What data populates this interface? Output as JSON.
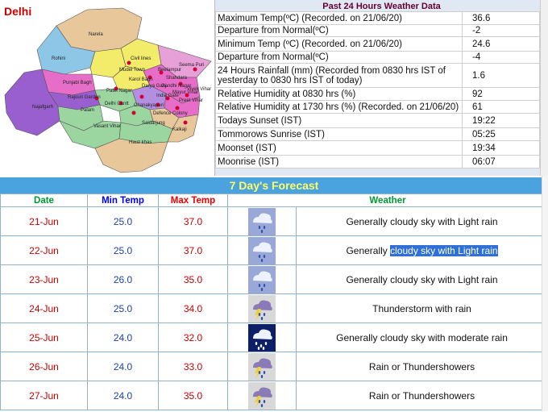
{
  "city": "Delhi",
  "map": {
    "districts": [
      "Narela",
      "Rohini",
      "Civil lines",
      "Seema Puri",
      "Mudel Town",
      "Shahdara",
      "Punjabi Bagh",
      "Karol Bagh",
      "Darya Ganj",
      "Rajouri Garden",
      "Patel Nagar",
      "Delhi Cantt",
      "Preet Vihar",
      "Najafgarh",
      "Palam",
      "Chanakyapuri",
      "Defence Colony",
      "Vasant Vihar",
      "Saidarjung",
      "Kalkaji",
      "Hauz khas",
      "Beelampur",
      "Gandhi Nagar",
      "Vivek Vihar",
      "Mayur Vihar",
      "India Gate"
    ]
  },
  "past": {
    "title": "Past 24 Hours Weather Data",
    "rows": [
      {
        "label": "Maximum Temp(ºC) (Recorded. on 21/06/20)",
        "value": "36.6"
      },
      {
        "label": "Departure from Normal(ºC)",
        "value": "-2"
      },
      {
        "label": "Minimum Temp (ºC) (Recorded. on 21/06/20)",
        "value": "24.6"
      },
      {
        "label": "Departure from Normal(ºC)",
        "value": "-4"
      },
      {
        "label": "24 Hours Rainfall (mm) (Recorded from 0830 hrs IST of yesterday to 0830 hrs IST of today)",
        "value": "1.6"
      },
      {
        "label": "Relative Humidity at 0830 hrs (%)",
        "value": "92"
      },
      {
        "label": "Relative Humidity at 1730 hrs (%) (Recorded. on 21/06/20)",
        "value": "61"
      },
      {
        "label": "Todays Sunset (IST)",
        "value": "19:22"
      },
      {
        "label": "Tommorows Sunrise (IST)",
        "value": "05:25"
      },
      {
        "label": "Moonset (IST)",
        "value": "19:34"
      },
      {
        "label": "Moonrise (IST)",
        "value": "06:07"
      }
    ]
  },
  "forecast": {
    "title": "7 Day's Forecast",
    "headers": {
      "date": "Date",
      "min": "Min Temp",
      "max": "Max Temp",
      "weather": "Weather"
    },
    "rows": [
      {
        "date": "21-Jun",
        "min": "25.0",
        "max": "37.0",
        "icon": "cloudy-light-rain-icon",
        "weather": "Generally cloudy sky with Light rain"
      },
      {
        "date": "22-Jun",
        "min": "25.0",
        "max": "37.0",
        "icon": "cloudy-light-rain-icon",
        "weather_pre": "Generally ",
        "weather_sel": "cloudy sky with Light rain"
      },
      {
        "date": "23-Jun",
        "min": "26.0",
        "max": "35.0",
        "icon": "cloudy-light-rain-icon",
        "weather": "Generally cloudy sky with Light rain"
      },
      {
        "date": "24-Jun",
        "min": "25.0",
        "max": "34.0",
        "icon": "thunderstorm-rain-icon",
        "weather": "Thunderstorm with rain"
      },
      {
        "date": "25-Jun",
        "min": "24.0",
        "max": "32.0",
        "icon": "moderate-rain-icon",
        "weather": "Generally cloudy sky with moderate rain"
      },
      {
        "date": "26-Jun",
        "min": "24.0",
        "max": "33.0",
        "icon": "thundershowers-icon",
        "weather": "Rain or Thundershowers"
      },
      {
        "date": "27-Jun",
        "min": "24.0",
        "max": "35.0",
        "icon": "thundershowers-icon",
        "weather": "Rain or Thundershowers"
      }
    ]
  },
  "colors": {
    "forecast_header": "#4aa3df",
    "forecast_title": "#ffff66",
    "date_text": "#cc0000",
    "min_text": "#1c3fa6",
    "selection": "#2f6fd6"
  }
}
